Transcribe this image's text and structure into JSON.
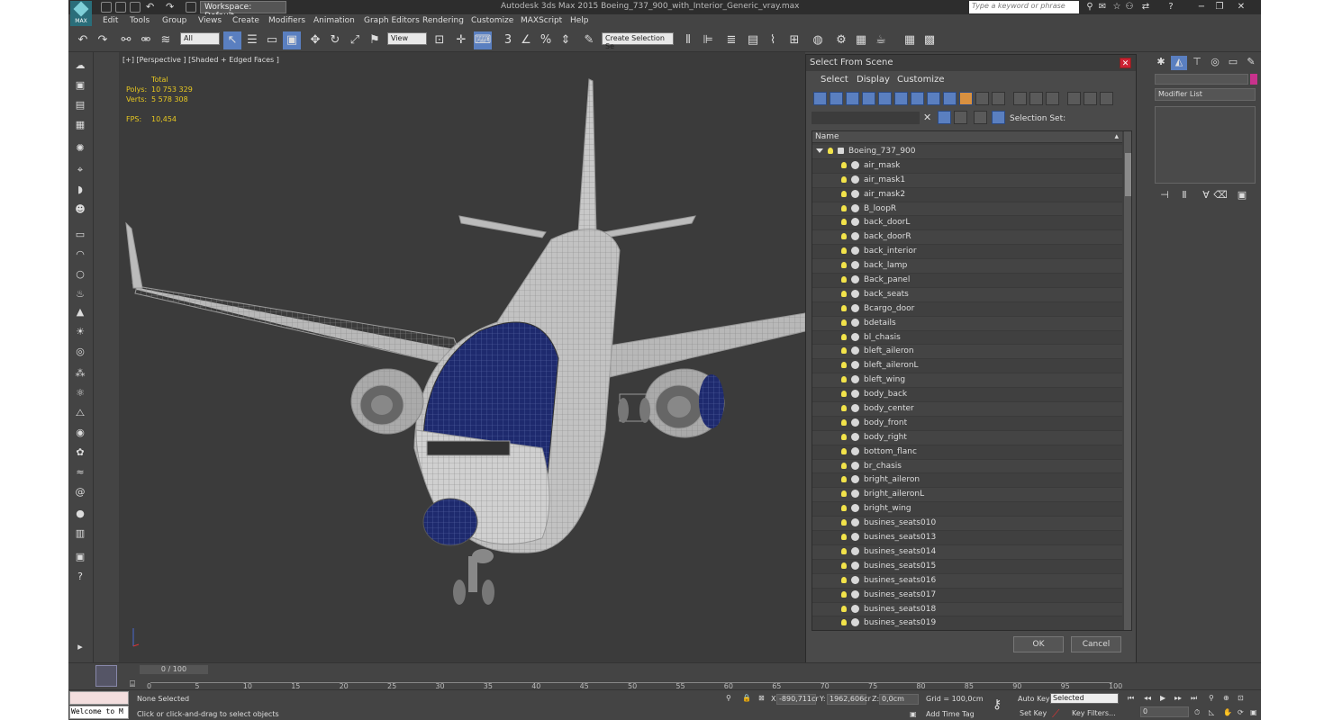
{
  "window": {
    "title": "Autodesk 3ds Max 2015    Boeing_737_900_with_Interior_Generic_vray.max",
    "logo": "MAX",
    "workspace": "Workspace: Default",
    "search_placeholder": "Type a keyword or phrase"
  },
  "menu": [
    "Edit",
    "Tools",
    "Group",
    "Views",
    "Create",
    "Modifiers",
    "Animation",
    "Graph Editors",
    "Rendering",
    "Customize",
    "MAXScript",
    "Help"
  ],
  "toolbar": {
    "selection_filter": "All",
    "ref_coord": "View",
    "named_selection": "Create Selection Se"
  },
  "viewport": {
    "label": "[+] [Perspective ] [Shaded + Edged Faces ]",
    "stats_header": "Total",
    "polys_label": "Polys:",
    "polys_value": "10 753 329",
    "verts_label": "Verts:",
    "verts_value": "5 578 308",
    "fps_label": "FPS:",
    "fps_value": "10,454"
  },
  "dialog": {
    "title": "Select From Scene",
    "menus": [
      "Select",
      "Display",
      "Customize"
    ],
    "selection_set_label": "Selection Set:",
    "column_header": "Name",
    "root": "Boeing_737_900",
    "items": [
      "air_mask",
      "air_mask1",
      "air_mask2",
      "B_loopR",
      "back_doorL",
      "back_doorR",
      "back_interior",
      "back_lamp",
      "Back_panel",
      "back_seats",
      "Bcargo_door",
      "bdetails",
      "bl_chasis",
      "bleft_aileron",
      "bleft_aileronL",
      "bleft_wing",
      "body_back",
      "body_center",
      "body_front",
      "body_right",
      "bottom_flanc",
      "br_chasis",
      "bright_aileron",
      "bright_aileronL",
      "bright_wing",
      "busines_seats010",
      "busines_seats013",
      "busines_seats014",
      "busines_seats015",
      "busines_seats016",
      "busines_seats017",
      "busines_seats018",
      "busines_seats019"
    ],
    "ok": "OK",
    "cancel": "Cancel"
  },
  "right_panel": {
    "modifier_list": "Modifier List"
  },
  "timeline": {
    "frame": "0 / 100",
    "ticks": [
      "0",
      "5",
      "10",
      "15",
      "20",
      "25",
      "30",
      "35",
      "40",
      "45",
      "50",
      "55",
      "60",
      "65",
      "70",
      "75",
      "80",
      "85",
      "90",
      "95",
      "100"
    ]
  },
  "status": {
    "listener": "Welcome to M",
    "selected": "None Selected",
    "prompt": "Click or click-and-drag to select objects",
    "x_label": "X:",
    "x_value": "-890,711cr",
    "y_label": "Y:",
    "y_value": "1962,606cr",
    "z_label": "Z:",
    "z_value": "0,0cm",
    "grid": "Grid = 100,0cm",
    "add_time_tag": "Add Time Tag",
    "auto_key": "Auto Key",
    "auto_key_value": "Selected",
    "set_key": "Set Key",
    "key_filters": "Key Filters...",
    "frame_field": "0"
  },
  "colors": {
    "ui_bg": "#444444",
    "viewport_bg": "#3b3b3b",
    "accent_blue": "#5a7fc0",
    "stats_yellow": "#e8c820",
    "fuselage_blue": "#1e2a6e"
  }
}
